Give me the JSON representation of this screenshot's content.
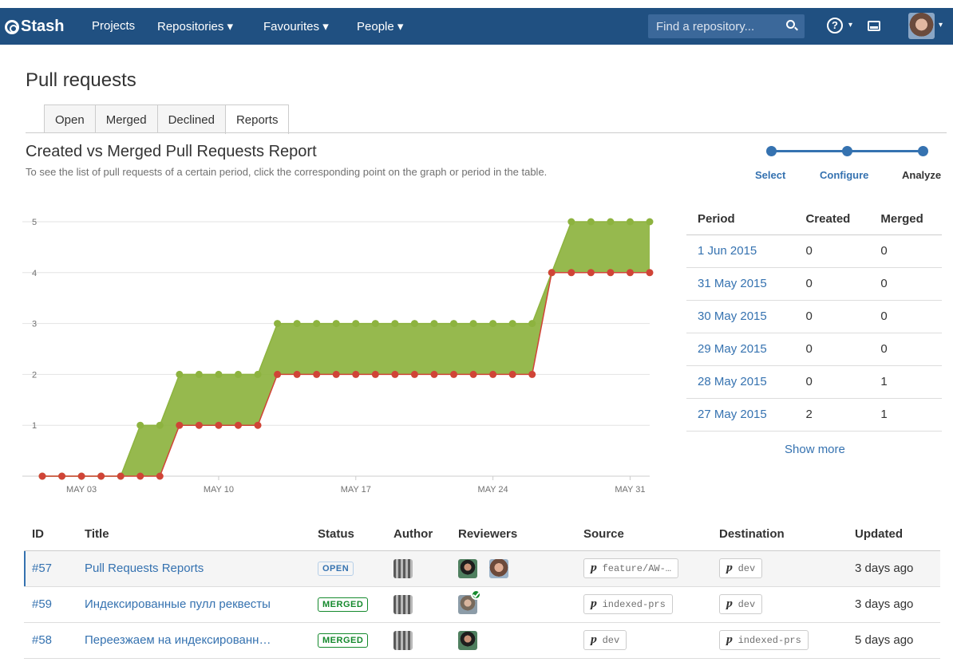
{
  "header": {
    "logo": "Stash",
    "nav": [
      {
        "label": "Projects"
      },
      {
        "label": "Repositories ▾"
      },
      {
        "label": "Favourites ▾"
      },
      {
        "label": "People ▾"
      }
    ],
    "search_placeholder": "Find a repository...",
    "help_label": "?"
  },
  "page": {
    "title": "Pull requests",
    "tabs": [
      "Open",
      "Merged",
      "Declined",
      "Reports"
    ],
    "active_tab": "Reports",
    "report_title": "Created vs Merged Pull Requests Report",
    "report_desc": "To see the list of pull requests of a certain period, click the corresponding point on the graph or period in the table."
  },
  "wizard": {
    "steps": [
      "Select",
      "Configure",
      "Analyze"
    ],
    "current": "Analyze"
  },
  "chart_data": {
    "type": "area",
    "x_tick_labels": [
      "MAY 03",
      "MAY 10",
      "MAY 17",
      "MAY 24",
      "MAY 31"
    ],
    "y_tick_labels": [
      "1",
      "2",
      "3",
      "4",
      "5"
    ],
    "ylim": [
      0,
      5
    ],
    "x": [
      "May 01",
      "May 02",
      "May 03",
      "May 04",
      "May 05",
      "May 06",
      "May 07",
      "May 08",
      "May 09",
      "May 10",
      "May 11",
      "May 12",
      "May 13",
      "May 14",
      "May 15",
      "May 16",
      "May 17",
      "May 18",
      "May 19",
      "May 20",
      "May 21",
      "May 22",
      "May 23",
      "May 24",
      "May 25",
      "May 26",
      "May 27",
      "May 28",
      "May 29",
      "May 30",
      "May 31",
      "Jun 01"
    ],
    "series": [
      {
        "color": "#8db33f",
        "values": [
          0,
          0,
          0,
          0,
          0,
          1,
          1,
          2,
          2,
          2,
          2,
          2,
          3,
          3,
          3,
          3,
          3,
          3,
          3,
          3,
          3,
          3,
          3,
          3,
          3,
          3,
          4,
          5,
          5,
          5,
          5,
          5
        ]
      },
      {
        "color": "#d04437",
        "values": [
          0,
          0,
          0,
          0,
          0,
          0,
          0,
          1,
          1,
          1,
          1,
          1,
          2,
          2,
          2,
          2,
          2,
          2,
          2,
          2,
          2,
          2,
          2,
          2,
          2,
          2,
          4,
          4,
          4,
          4,
          4,
          4
        ]
      }
    ],
    "grid": true
  },
  "period_table": {
    "headers": [
      "Period",
      "Created",
      "Merged"
    ],
    "rows": [
      {
        "period": "1 Jun 2015",
        "created": "0",
        "merged": "0"
      },
      {
        "period": "31 May 2015",
        "created": "0",
        "merged": "0"
      },
      {
        "period": "30 May 2015",
        "created": "0",
        "merged": "0"
      },
      {
        "period": "29 May 2015",
        "created": "0",
        "merged": "0"
      },
      {
        "period": "28 May 2015",
        "created": "0",
        "merged": "1"
      },
      {
        "period": "27 May 2015",
        "created": "2",
        "merged": "1"
      }
    ],
    "show_more": "Show more"
  },
  "pr_table": {
    "headers": [
      "ID",
      "Title",
      "Status",
      "Author",
      "Reviewers",
      "Source",
      "Destination",
      "Updated"
    ],
    "rows": [
      {
        "id": "#57",
        "title": "Pull Requests Reports",
        "status": "OPEN",
        "source": "feature/AW-…",
        "destination": "dev",
        "updated": "3 days ago"
      },
      {
        "id": "#59",
        "title": "Индексированные пулл реквесты",
        "status": "MERGED",
        "source": "indexed-prs",
        "destination": "dev",
        "updated": "3 days ago"
      },
      {
        "id": "#58",
        "title": "Переезжаем на индексированн…",
        "status": "MERGED",
        "source": "dev",
        "destination": "indexed-prs",
        "updated": "5 days ago"
      }
    ]
  }
}
